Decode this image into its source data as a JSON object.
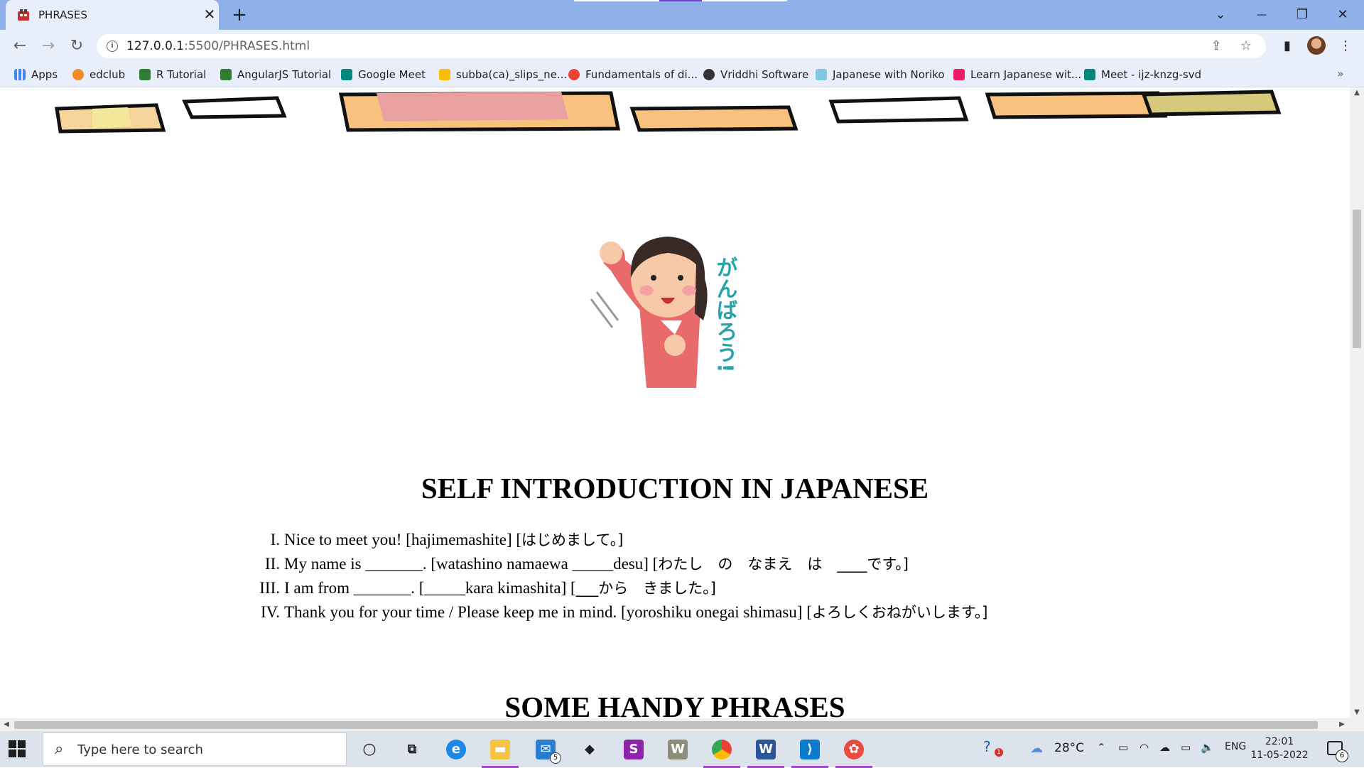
{
  "browser": {
    "tab": {
      "title": "PHRASES",
      "close_label": "✕"
    },
    "new_tab_label": "+",
    "window_controls": {
      "tabsearch": "⌄",
      "minimize": "—",
      "restore": "❐",
      "close": "✕"
    },
    "address": {
      "host": "127.0.0.1",
      "path": ":5500/PHRASES.html"
    },
    "bookmarks": [
      {
        "label": "Apps",
        "color": "#4285f4"
      },
      {
        "label": "edclub",
        "color": "#f28b25"
      },
      {
        "label": "R Tutorial",
        "color": "#2e7d32"
      },
      {
        "label": "AngularJS Tutorial",
        "color": "#2e7d32"
      },
      {
        "label": "Google Meet",
        "color": "#00897b"
      },
      {
        "label": "subba(ca)_slips_ne...",
        "color": "#fbbc04"
      },
      {
        "label": "Fundamentals of di...",
        "color": "#ea4335"
      },
      {
        "label": "Vriddhi Software",
        "color": "#333333"
      },
      {
        "label": "Japanese with Noriko",
        "color": "#7ec8e3"
      },
      {
        "label": "Learn Japanese wit...",
        "color": "#e91e63"
      },
      {
        "label": "Meet - ijz-knzg-svd",
        "color": "#00897b"
      }
    ],
    "bookmarks_overflow": "»"
  },
  "page": {
    "mascot_caption": "がんばろう!",
    "heading_self": "SELF INTRODUCTION IN JAPANESE",
    "phrases": [
      {
        "num": "I.",
        "en": "Nice to meet you! [hajimemashite] [",
        "jp": "はじめまして。]"
      },
      {
        "num": "II.",
        "en": "My name is _______. [watashino namaewa _____desu] [",
        "jp": "わたし　の　なまえ　は　____です。]"
      },
      {
        "num": "III.",
        "en": "I am from _______. [_____kara kimashita] [",
        "jp": "___から　きました。]"
      },
      {
        "num": "IV.",
        "en": "Thank you for your time / Please keep me in mind. [yoroshiku onegai shimasu] [",
        "jp": "よろしくおねがいします。]"
      }
    ],
    "heading_handy": "SOME HANDY PHRASES"
  },
  "taskbar": {
    "search_placeholder": "Type here to search",
    "mail_badge": "5",
    "weather": "28°C",
    "language": "ENG",
    "time": "22:01",
    "date": "11-05-2022",
    "notification_count": "6",
    "help_badge": "1"
  },
  "colors": {
    "tabstrip": "#8fb0e8",
    "toolbar": "#e8effb",
    "taskbar": "#dde3ec",
    "accent_underline": "#a447d1"
  }
}
